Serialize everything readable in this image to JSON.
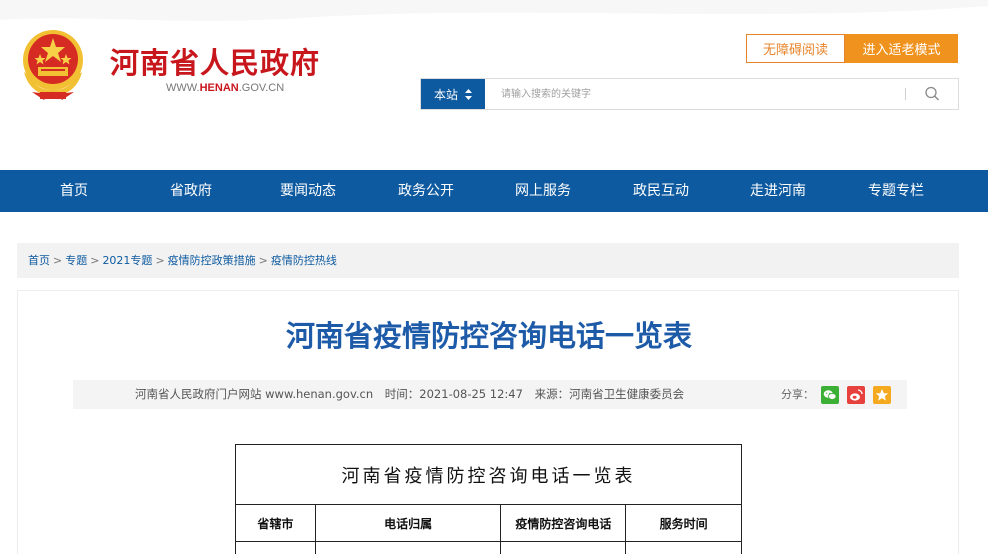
{
  "site": {
    "title": "河南省人民政府",
    "url_prefix": "WWW.",
    "url_brand": "HENAN",
    "url_suffix": ".GOV.CN"
  },
  "accessibility": {
    "barrier_free_label": "无障碍阅读",
    "elder_mode_label": "进入适老模式"
  },
  "search": {
    "scope_label": "本站",
    "placeholder": "请输入搜索的关键字"
  },
  "nav": {
    "items": [
      "首页",
      "省政府",
      "要闻动态",
      "政务公开",
      "网上服务",
      "政民互动",
      "走进河南",
      "专题专栏"
    ]
  },
  "breadcrumb": [
    "首页",
    "专题",
    "2021专题",
    "疫情防控政策措施",
    "疫情防控热线"
  ],
  "breadcrumb_sep": ">",
  "article": {
    "title": "河南省疫情防控咨询电话一览表",
    "publisher": "河南省人民政府门户网站 www.henan.gov.cn",
    "time": "时间：2021-08-25 12:47",
    "source": "来源：河南省卫生健康委员会",
    "share_label": "分享："
  },
  "table": {
    "caption": "河南省疫情防控咨询电话一览表",
    "headers": [
      "省辖市",
      "电话归属",
      "疫情防控咨询电话",
      "服务时间"
    ]
  },
  "colors": {
    "brand_red": "#c8161d",
    "nav_blue": "#0e5aa0",
    "title_blue": "#1d5aa8",
    "accent_orange": "#f0921e"
  },
  "icons": {
    "search": "magnifier-icon",
    "share": [
      "wechat-icon",
      "weibo-icon",
      "favorite-star-icon"
    ]
  }
}
